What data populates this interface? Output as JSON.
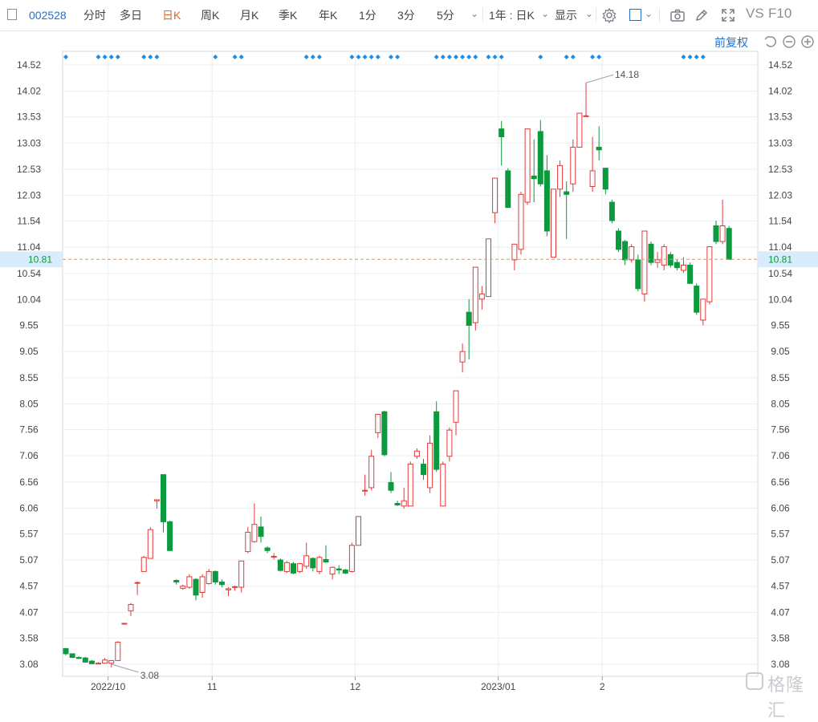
{
  "toolbar": {
    "code": "002528",
    "tabs": [
      "分时",
      "多日",
      "日K",
      "周K",
      "月K",
      "季K",
      "年K",
      "1分",
      "3分",
      "5分"
    ],
    "active_tab": "日K",
    "range_select": "1年 : 日K",
    "display_label": "显示",
    "vs_label": "VS",
    "f10_label": "F10"
  },
  "fuquan_label": "前复权",
  "watermark": "格隆汇",
  "colors": {
    "up": "#e2393a",
    "down": "#0b9a3d",
    "current_line": "#f0933a",
    "current_label_bg": "#d9ecfb",
    "current_label_text": "#0b9a3d",
    "marker": "#1e8ce6",
    "grid": "#eceef1",
    "axis_text": "#444444",
    "link": "#1f6fd1"
  },
  "chart_data": {
    "type": "candlestick",
    "title": "",
    "xlabel": "",
    "ylabel": "",
    "ylim": [
      2.85,
      14.75
    ],
    "y_ticks": [
      "14.52",
      "14.02",
      "13.53",
      "13.03",
      "12.53",
      "12.03",
      "11.54",
      "11.04",
      "10.54",
      "10.04",
      "9.55",
      "9.05",
      "8.55",
      "8.05",
      "7.56",
      "7.06",
      "6.56",
      "6.06",
      "5.57",
      "5.07",
      "4.57",
      "4.07",
      "3.58",
      "3.08"
    ],
    "x_labels": [
      "2022/10",
      "11",
      "12",
      "2023/01",
      "2"
    ],
    "month_starts": [
      7,
      23,
      45,
      67,
      83
    ],
    "current_price": "10.81",
    "max_label": "14.18",
    "max_index": 80,
    "min_label": "3.08",
    "min_index": 7,
    "grid": true,
    "ohlc": [
      [
        3.38,
        3.38,
        3.25,
        3.28
      ],
      [
        3.28,
        3.28,
        3.2,
        3.21
      ],
      [
        3.21,
        3.23,
        3.18,
        3.19
      ],
      [
        3.2,
        3.22,
        3.11,
        3.12
      ],
      [
        3.14,
        3.16,
        3.09,
        3.09
      ],
      [
        3.09,
        3.12,
        3.08,
        3.1
      ],
      [
        3.1,
        3.2,
        3.09,
        3.16
      ],
      [
        3.1,
        3.16,
        3.02,
        3.15
      ],
      [
        3.15,
        3.52,
        3.15,
        3.5
      ],
      [
        3.85,
        3.87,
        3.84,
        3.86
      ],
      [
        4.1,
        4.25,
        4.0,
        4.22
      ],
      [
        4.63,
        4.66,
        4.4,
        4.64
      ],
      [
        4.85,
        5.15,
        4.85,
        5.12
      ],
      [
        5.1,
        5.7,
        5.1,
        5.65
      ],
      [
        6.2,
        6.22,
        6.05,
        6.22
      ],
      [
        6.7,
        6.7,
        5.6,
        5.8
      ],
      [
        5.8,
        5.82,
        5.25,
        5.25
      ],
      [
        4.68,
        4.7,
        4.6,
        4.65
      ],
      [
        4.53,
        4.6,
        4.5,
        4.57
      ],
      [
        4.55,
        4.8,
        4.52,
        4.75
      ],
      [
        4.7,
        4.72,
        4.3,
        4.4
      ],
      [
        4.45,
        4.8,
        4.35,
        4.75
      ],
      [
        4.62,
        4.9,
        4.6,
        4.85
      ],
      [
        4.85,
        4.87,
        4.6,
        4.65
      ],
      [
        4.65,
        4.7,
        4.55,
        4.6
      ],
      [
        4.5,
        4.55,
        4.38,
        4.52
      ],
      [
        4.55,
        4.58,
        4.48,
        4.56
      ],
      [
        4.55,
        5.05,
        4.45,
        5.05
      ],
      [
        5.23,
        5.7,
        5.2,
        5.6
      ],
      [
        5.42,
        6.15,
        5.4,
        5.75
      ],
      [
        5.7,
        5.9,
        5.4,
        5.52
      ],
      [
        5.3,
        5.33,
        5.2,
        5.25
      ],
      [
        5.13,
        5.2,
        5.08,
        5.14
      ],
      [
        5.07,
        5.1,
        4.85,
        4.87
      ],
      [
        4.85,
        5.05,
        4.82,
        5.02
      ],
      [
        5.0,
        5.03,
        4.8,
        4.82
      ],
      [
        4.85,
        5.01,
        4.82,
        5.0
      ],
      [
        4.95,
        5.4,
        4.9,
        5.15
      ],
      [
        5.1,
        5.12,
        4.85,
        4.92
      ],
      [
        4.85,
        5.15,
        4.8,
        5.12
      ],
      [
        5.08,
        5.35,
        5.02,
        5.03
      ],
      [
        4.8,
        4.95,
        4.7,
        4.93
      ],
      [
        4.9,
        4.97,
        4.8,
        4.88
      ],
      [
        4.88,
        4.9,
        4.8,
        4.82
      ],
      [
        4.85,
        5.4,
        4.83,
        5.35
      ],
      [
        5.35,
        5.9,
        5.35,
        5.9
      ],
      [
        6.4,
        6.7,
        6.3,
        6.4
      ],
      [
        6.45,
        7.17,
        6.4,
        7.05
      ],
      [
        7.5,
        7.86,
        7.4,
        7.85
      ],
      [
        7.9,
        7.92,
        7.05,
        7.08
      ],
      [
        6.55,
        6.75,
        6.35,
        6.4
      ],
      [
        6.15,
        6.2,
        6.1,
        6.12
      ],
      [
        6.1,
        6.45,
        6.05,
        6.2
      ],
      [
        6.1,
        6.95,
        6.1,
        6.9
      ],
      [
        7.05,
        7.2,
        7.0,
        7.15
      ],
      [
        6.9,
        7.0,
        6.6,
        6.7
      ],
      [
        6.45,
        7.45,
        6.35,
        7.3
      ],
      [
        7.9,
        8.1,
        6.75,
        6.8
      ],
      [
        6.1,
        6.95,
        6.1,
        6.9
      ],
      [
        7.05,
        7.6,
        6.95,
        7.55
      ],
      [
        7.7,
        8.3,
        7.45,
        8.3
      ],
      [
        8.85,
        9.2,
        8.65,
        9.05
      ],
      [
        9.8,
        10.05,
        8.9,
        9.55
      ],
      [
        9.6,
        10.66,
        9.45,
        10.66
      ],
      [
        10.05,
        10.3,
        9.85,
        10.15
      ],
      [
        10.1,
        11.2,
        10.1,
        11.2
      ],
      [
        11.7,
        12.36,
        11.5,
        12.36
      ],
      [
        13.3,
        13.45,
        12.6,
        13.15
      ],
      [
        12.5,
        12.55,
        11.8,
        11.8
      ],
      [
        10.8,
        11.1,
        10.6,
        11.1
      ],
      [
        11.0,
        12.1,
        10.9,
        12.05
      ],
      [
        11.9,
        13.3,
        11.85,
        13.3
      ],
      [
        12.4,
        13.1,
        11.9,
        12.35
      ],
      [
        13.25,
        13.47,
        12.2,
        12.25
      ],
      [
        12.5,
        12.8,
        11.25,
        11.35
      ],
      [
        10.85,
        12.15,
        10.85,
        12.15
      ],
      [
        12.15,
        12.7,
        12.0,
        12.6
      ],
      [
        12.1,
        12.3,
        11.2,
        12.05
      ],
      [
        12.25,
        13.1,
        12.1,
        12.95
      ],
      [
        12.95,
        13.6,
        12.95,
        13.6
      ],
      [
        13.55,
        14.18,
        13.55,
        13.55
      ],
      [
        12.2,
        13.15,
        12.1,
        12.5
      ],
      [
        12.95,
        13.35,
        12.7,
        12.9
      ],
      [
        12.55,
        12.55,
        12.05,
        12.15
      ],
      [
        11.9,
        11.95,
        11.5,
        11.55
      ],
      [
        11.35,
        11.4,
        10.95,
        11.0
      ],
      [
        11.15,
        11.18,
        10.7,
        10.8
      ],
      [
        10.8,
        11.1,
        10.75,
        11.05
      ],
      [
        10.8,
        10.9,
        10.2,
        10.25
      ],
      [
        10.15,
        11.35,
        10.0,
        11.35
      ],
      [
        11.1,
        11.15,
        10.7,
        10.75
      ],
      [
        10.75,
        10.95,
        10.65,
        10.8
      ],
      [
        10.7,
        11.1,
        10.6,
        11.05
      ],
      [
        10.9,
        10.95,
        10.65,
        10.7
      ],
      [
        10.75,
        10.8,
        10.6,
        10.65
      ],
      [
        10.6,
        10.85,
        10.55,
        10.7
      ],
      [
        10.7,
        10.75,
        10.35,
        10.35
      ],
      [
        10.3,
        10.35,
        9.75,
        9.8
      ],
      [
        9.65,
        10.05,
        9.55,
        10.05
      ],
      [
        10.0,
        11.05,
        9.95,
        11.05
      ],
      [
        11.45,
        11.55,
        11.1,
        11.15
      ],
      [
        11.15,
        11.95,
        11.1,
        11.45
      ],
      [
        11.4,
        11.45,
        10.81,
        10.81
      ]
    ],
    "markers": [
      0,
      5,
      6,
      7,
      8,
      12,
      13,
      14,
      23,
      26,
      27,
      37,
      38,
      39,
      44,
      45,
      46,
      47,
      48,
      50,
      51,
      57,
      58,
      59,
      60,
      61,
      62,
      63,
      65,
      66,
      67,
      73,
      77,
      78,
      81,
      82,
      95,
      96,
      97,
      98
    ]
  }
}
